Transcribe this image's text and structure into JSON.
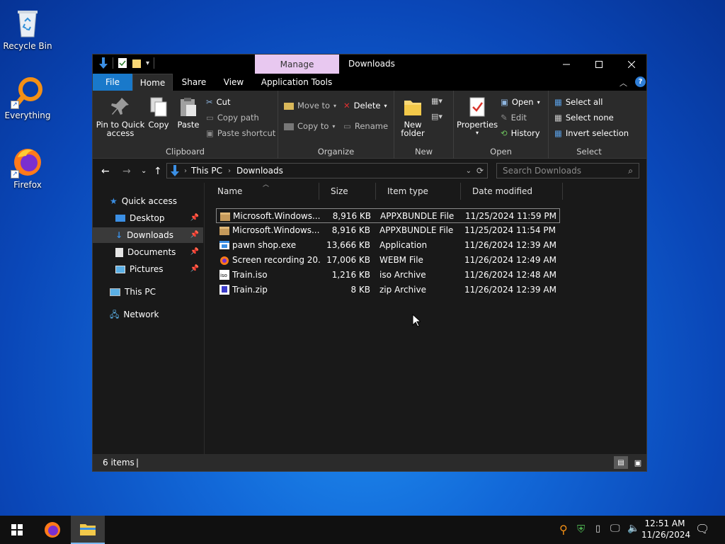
{
  "desktop": {
    "icons": [
      {
        "label": "Recycle Bin"
      },
      {
        "label": "Everything"
      },
      {
        "label": "Firefox"
      }
    ]
  },
  "window": {
    "title": "Downloads",
    "manage_tab": "Manage",
    "tabs": [
      "File",
      "Home",
      "Share",
      "View",
      "Application Tools"
    ],
    "ribbon": {
      "clipboard": {
        "label": "Clipboard",
        "pin_line1": "Pin to Quick",
        "pin_line2": "access",
        "copy": "Copy",
        "paste": "Paste",
        "cut": "Cut",
        "copy_path": "Copy path",
        "paste_shortcut": "Paste shortcut"
      },
      "organize": {
        "label": "Organize",
        "move_to": "Move to",
        "copy_to": "Copy to",
        "delete": "Delete",
        "rename": "Rename"
      },
      "new": {
        "label": "New",
        "new_folder_line1": "New",
        "new_folder_line2": "folder"
      },
      "open": {
        "label": "Open",
        "properties": "Properties",
        "open": "Open",
        "edit": "Edit",
        "history": "History"
      },
      "select": {
        "label": "Select",
        "select_all": "Select all",
        "select_none": "Select none",
        "invert": "Invert selection"
      }
    },
    "address": {
      "crumbs": [
        "This PC",
        "Downloads"
      ],
      "search_placeholder": "Search Downloads"
    },
    "nav": {
      "quick_access": "Quick access",
      "desktop": "Desktop",
      "downloads": "Downloads",
      "documents": "Documents",
      "pictures": "Pictures",
      "this_pc": "This PC",
      "network": "Network"
    },
    "columns": {
      "name": "Name",
      "size": "Size",
      "type": "Item type",
      "date": "Date modified"
    },
    "files": [
      {
        "name": "Microsoft.Windows...",
        "size": "8,916 KB",
        "type": "APPXBUNDLE File",
        "date": "11/25/2024 11:59 PM",
        "icon": "package-icon"
      },
      {
        "name": "Microsoft.Windows...",
        "size": "8,916 KB",
        "type": "APPXBUNDLE File",
        "date": "11/25/2024 11:54 PM",
        "icon": "package-icon"
      },
      {
        "name": "pawn shop.exe",
        "size": "13,666 KB",
        "type": "Application",
        "date": "11/26/2024 12:39 AM",
        "icon": "application-icon"
      },
      {
        "name": "Screen recording 20...",
        "size": "17,006 KB",
        "type": "WEBM File",
        "date": "11/26/2024 12:49 AM",
        "icon": "video-icon"
      },
      {
        "name": "Train.iso",
        "size": "1,216 KB",
        "type": "iso Archive",
        "date": "11/26/2024 12:48 AM",
        "icon": "iso-icon"
      },
      {
        "name": "Train.zip",
        "size": "8 KB",
        "type": "zip Archive",
        "date": "11/26/2024 12:39 AM",
        "icon": "zip-icon"
      }
    ],
    "status": "6 items"
  },
  "taskbar": {
    "time": "12:51 AM",
    "date": "11/26/2024"
  }
}
